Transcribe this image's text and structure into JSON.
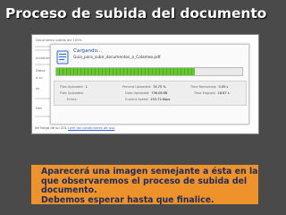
{
  "slide": {
    "title": "Proceso de subida del documento"
  },
  "screenshot": {
    "background_lines": [
      "Documento subido del 100%",
      "Arrastrar",
      "Datos",
      "a su",
      "as",
      "Des"
    ],
    "dialog": {
      "loading_label": "Cargando...",
      "file_name": "Guia_para_subir_documentos_a_Calameo.pdf",
      "progress_percent": 74.75,
      "progress_color": "#5bbd2b",
      "stats": {
        "files_uploaded": {
          "label": "Files Uploaded:",
          "value": "1"
        },
        "files_uploaded_remaining": {
          "label": "Files Uploaded:",
          "value": ""
        },
        "errors": {
          "label": "Errors:",
          "value": ""
        },
        "percent_uploaded": {
          "label": "Percent Uploaded:",
          "value": "74.75 %"
        },
        "data_uploaded": {
          "label": "Data Uploaded:",
          "value": "736.08 KB"
        },
        "current_speed": {
          "label": "Current Speed:",
          "value": "253.72 Kbps"
        },
        "time_remaining": {
          "label": "Time Remaining:",
          "value": "5.05 s"
        },
        "time_elapsed": {
          "label": "Time Elapsed:",
          "value": "18.67 s"
        }
      }
    },
    "bottom_note": {
      "text": "ite targa de su 20L",
      "link": "Leer las condiciones de uso"
    }
  },
  "caption": {
    "lines": [
      "Aparecerá una imagen semejante a ésta en la",
      "que observaremos el proceso de subida del",
      "documento.",
      "Debemos esperar hasta que finalice."
    ]
  },
  "colors": {
    "slide_background": "#4a4a4a",
    "caption_background": "#ee932c",
    "caption_text": "#1e2a5a"
  }
}
